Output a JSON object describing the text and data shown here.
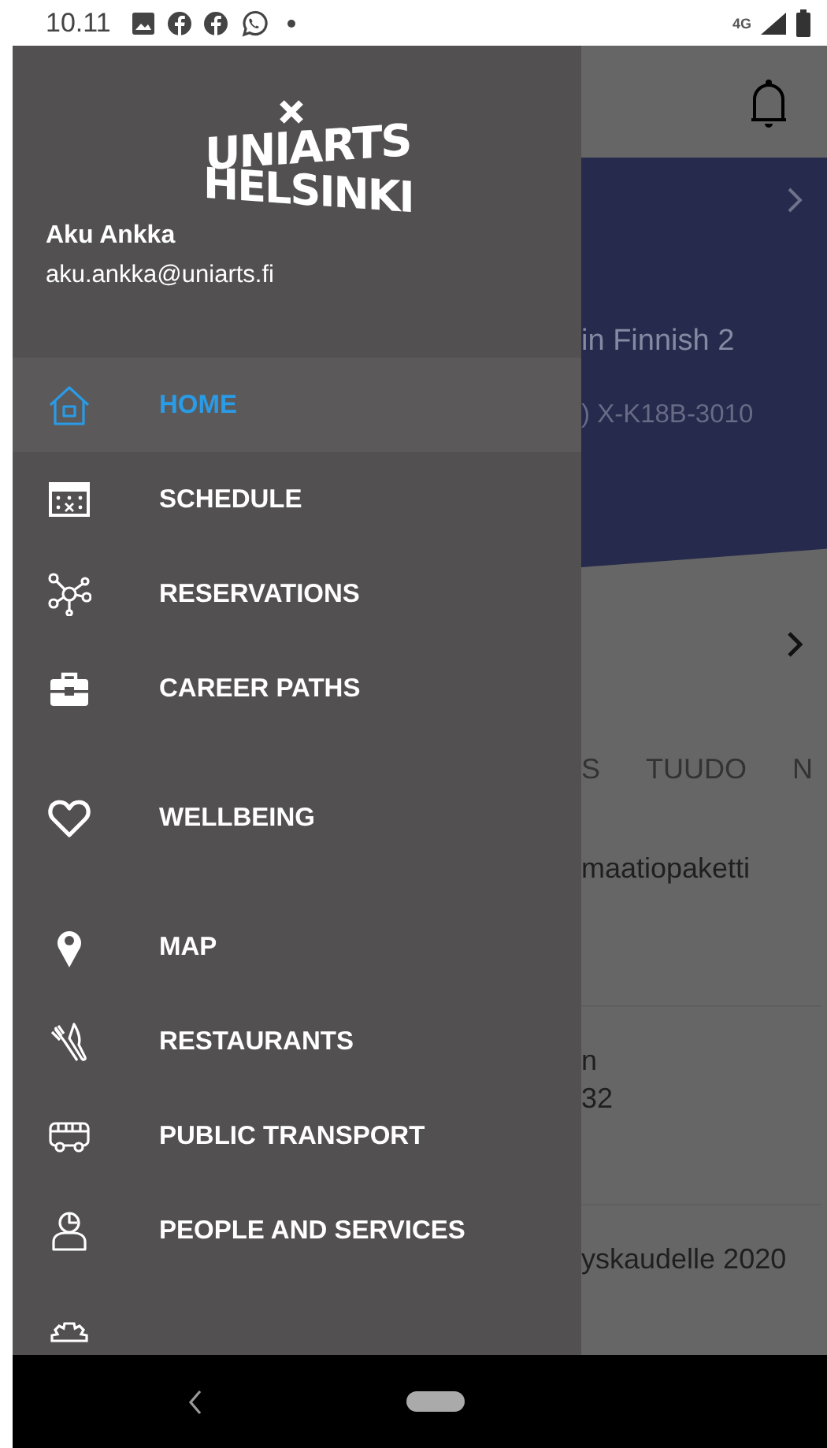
{
  "status_bar": {
    "time": "10.11",
    "network": "4G"
  },
  "drawer": {
    "logo": {
      "line_1": "UNIARTS",
      "line_2": "HELSINKI"
    },
    "user": {
      "name": "Aku Ankka",
      "email": "aku.ankka@uniarts.fi"
    },
    "items": [
      {
        "label": "HOME",
        "selected": true
      },
      {
        "label": "SCHEDULE",
        "selected": false
      },
      {
        "label": "RESERVATIONS",
        "selected": false
      },
      {
        "label": "CAREER PATHS",
        "selected": false
      },
      {
        "label": "WELLBEING",
        "selected": false
      },
      {
        "label": "MAP",
        "selected": false
      },
      {
        "label": "RESTAURANTS",
        "selected": false
      },
      {
        "label": "PUBLIC TRANSPORT",
        "selected": false
      },
      {
        "label": "PEOPLE AND SERVICES",
        "selected": false
      }
    ]
  },
  "background": {
    "card": {
      "title": "in Finnish 2",
      "code": ") X-K18B-3010"
    },
    "tabs": [
      {
        "label": "S"
      },
      {
        "label": "TUUDO"
      },
      {
        "label": "N"
      }
    ],
    "list": [
      {
        "lines": [
          "maatiopaketti"
        ]
      },
      {
        "lines": [
          "n",
          "32"
        ]
      },
      {
        "lines": [
          "yskaudelle 2020"
        ]
      }
    ]
  }
}
